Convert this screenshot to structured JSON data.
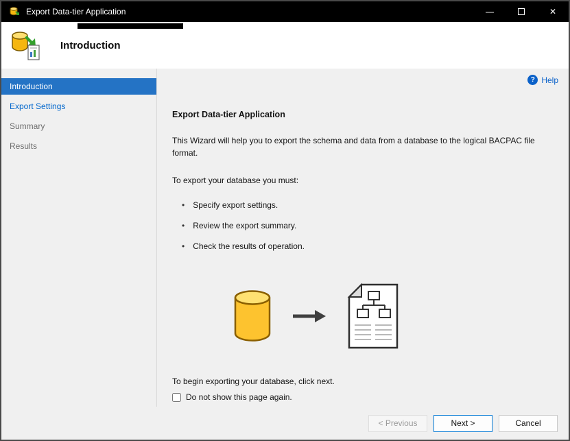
{
  "window": {
    "title": "Export Data-tier Application"
  },
  "glyphs": {
    "minimize": "—",
    "close": "✕",
    "help": "?",
    "bullet": "•"
  },
  "header": {
    "title": "Introduction"
  },
  "sidebar": {
    "items": [
      {
        "label": "Introduction",
        "state": "selected"
      },
      {
        "label": "Export Settings",
        "state": "link"
      },
      {
        "label": "Summary",
        "state": "disabled"
      },
      {
        "label": "Results",
        "state": "disabled"
      }
    ]
  },
  "content": {
    "help_label": "Help",
    "heading": "Export Data-tier Application",
    "intro": "This Wizard will help you to export the schema and data from a database to the logical BACPAC file format.",
    "list_intro": "To export your database you must:",
    "bullets": [
      "Specify export settings.",
      "Review the export summary.",
      "Check the results of operation."
    ],
    "footer_text": "To begin exporting your database, click next.",
    "checkbox_label": "Do not show this page again.",
    "checkbox_checked": false
  },
  "buttons": {
    "previous": "< Previous",
    "next": "Next >",
    "cancel": "Cancel"
  },
  "colors": {
    "titlebar": "#000000",
    "nav_selected": "#2473c5",
    "link": "#0066cc",
    "accent": "#0078d4"
  }
}
